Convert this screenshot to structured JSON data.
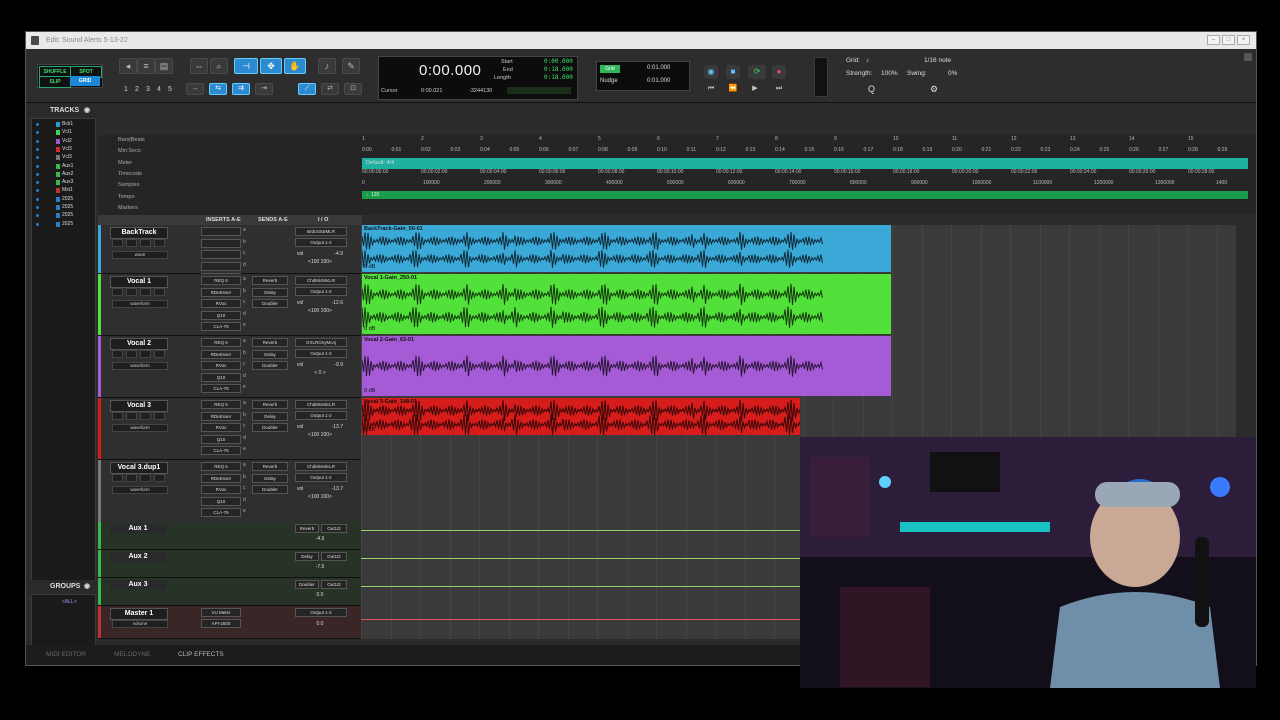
{
  "window": {
    "title": "Edit: Sound Alerts 5-13-22",
    "controls": [
      "–",
      "□",
      "×"
    ]
  },
  "toolbar": {
    "modes": [
      "SHUFFLE",
      "SPOT",
      "SLIP",
      "GRID"
    ],
    "zoom_presets": [
      "1",
      "2",
      "3",
      "4",
      "5"
    ],
    "counter": {
      "main": "0:00.000",
      "cursor_label": "Cursor",
      "cursor_value": "0:00.021",
      "sample": "-3244130",
      "start_label": "Start",
      "end_label": "End",
      "length_label": "Length",
      "start": "0:00.000",
      "end": "0:18.000",
      "length": "0:18.000"
    },
    "grid": {
      "badge": "Grid",
      "grid_value": "0:01.000",
      "nudge_label": "Nudge",
      "nudge_value": "0:01.000"
    },
    "quantize": {
      "grid_label": "Grid:",
      "grid_value": "1/16 note",
      "strength_label": "Strength:",
      "strength_value": "100%",
      "swing_label": "Swing:",
      "swing_value": "0%"
    }
  },
  "tracks_panel": {
    "header": "TRACKS",
    "items": [
      {
        "name": "Bck1",
        "color": "#2a9bd6"
      },
      {
        "name": "Vcl1",
        "color": "#3fd35a"
      },
      {
        "name": "Vcl2",
        "color": "#9b59d0"
      },
      {
        "name": "Vcl3",
        "color": "#d12a2a"
      },
      {
        "name": "Vcl3",
        "color": "#777777"
      },
      {
        "name": "Aux1",
        "color": "#3ab84a"
      },
      {
        "name": "Aux2",
        "color": "#3ab84a"
      },
      {
        "name": "Aux3",
        "color": "#3ab84a"
      },
      {
        "name": "Mst1",
        "color": "#c23030"
      },
      {
        "name": "2025",
        "color": "#2a7ac4"
      },
      {
        "name": "2025",
        "color": "#2a7ac4"
      },
      {
        "name": "2025",
        "color": "#2a7ac4"
      },
      {
        "name": "2025",
        "color": "#2a7ac4"
      }
    ]
  },
  "groups_panel": {
    "header": "GROUPS",
    "item": "<ALL>"
  },
  "rulers": {
    "labels": [
      "Bars|Beats",
      "Min:Secs",
      "Meter",
      "Timecode",
      "Samples",
      "Tempo",
      "Markers"
    ],
    "minsecs": [
      "0:00",
      "0:01",
      "0:02",
      "0:03",
      "0:04",
      "0:05",
      "0:06",
      "0:07",
      "0:08",
      "0:09",
      "0:10",
      "0:11",
      "0:12",
      "0:13",
      "0:14",
      "0:15",
      "0:16",
      "0:17",
      "0:18",
      "0:19",
      "0:20",
      "0:21",
      "0:22",
      "0:23",
      "0:24",
      "0:25",
      "0:26",
      "0:27",
      "0:28",
      "0:29"
    ],
    "bars": [
      "1",
      "2",
      "3",
      "4",
      "5",
      "6",
      "7",
      "8",
      "9",
      "10",
      "11",
      "12",
      "13",
      "14",
      "15"
    ],
    "timecode": [
      "00:00:00:00",
      "00:00:02:00",
      "00:00:04:00",
      "00:00:06:00",
      "00:00:08:00",
      "00:00:10:00",
      "00:00:12:00",
      "00:00:14:00",
      "00:00:16:00",
      "00:00:18:00",
      "00:00:20:00",
      "00:00:22:00",
      "00:00:24:00",
      "00:00:26:00",
      "00:00:28:00"
    ],
    "samples": [
      "0",
      "100000",
      "200000",
      "300000",
      "400000",
      "500000",
      "600000",
      "700000",
      "800000",
      "900000",
      "1000000",
      "1100000",
      "1200000",
      "1300000",
      "1400"
    ],
    "meter": "Default: 4/4",
    "tempo": "♩120"
  },
  "column_headers": {
    "inserts": "INSERTS A-E",
    "sends": "SENDS A-E",
    "io": "I / O"
  },
  "audio_tracks": [
    {
      "name": "BackTrack",
      "color": "#3aa9d8",
      "clip": "BackTrack-Gain_50-01",
      "gain": "0 dB",
      "view": "wave",
      "inserts": [
        "",
        "",
        "",
        "",
        ""
      ],
      "sends": [
        "",
        "",
        "",
        "",
        ""
      ],
      "io_in": "BrdcstStrMLR",
      "io_out": "Output 1-2",
      "vol": "-4.9",
      "pan": "<100  100>",
      "vol_label": "vol"
    },
    {
      "name": "Vocal 1",
      "color": "#52e03a",
      "clip": "Vocal 1-Gain_250-01",
      "gain": "0 dB",
      "view": "waveform",
      "inserts": [
        "REQ 6",
        "RDeEsser",
        "RVox",
        "Q10",
        "CLA-76"
      ],
      "sends": [
        "Reverb",
        "Delay",
        "Doubler",
        "",
        ""
      ],
      "io_in": "ChdMicMicLR",
      "io_out": "Output 1-2",
      "vol": "-12.6",
      "pan": "<100  100>",
      "vol_label": "vol"
    },
    {
      "name": "Vocal 2",
      "color": "#a55ad6",
      "clip": "Vocal 2-Gain_63-01",
      "gain": "0 dB",
      "view": "waveform",
      "inserts": [
        "REQ 6",
        "RDeEsser",
        "RVox",
        "Q10",
        "CLA-76"
      ],
      "sends": [
        "Reverb",
        "Delay",
        "Doubler",
        "",
        ""
      ],
      "io_in": "GXLROnyMcnj",
      "io_out": "Output 1-2",
      "vol": "-9.9",
      "pan": "< 0 >",
      "vol_label": "vol"
    },
    {
      "name": "Vocal 3",
      "color": "#d71c1c",
      "clip": "Vocal 3-Gain_148-01",
      "gain": "0 dB",
      "view": "waveform",
      "inserts": [
        "REQ 6",
        "RDeEsser",
        "RVox",
        "Q10",
        "CLA-76"
      ],
      "sends": [
        "Reverb",
        "Delay",
        "Doubler",
        "",
        ""
      ],
      "io_in": "ChdMicMicLR",
      "io_out": "Output 1-2",
      "vol": "-13.7",
      "pan": "<100  100>",
      "vol_label": "vol"
    },
    {
      "name": "Vocal 3.dup1",
      "color": "#7a7a7a",
      "clip": "",
      "gain": "",
      "view": "waveform",
      "inserts": [
        "REQ 6",
        "RDeEsser",
        "RVox",
        "Q10",
        "CLA-76"
      ],
      "sends": [
        "Reverb",
        "Delay",
        "Doubler",
        "",
        ""
      ],
      "io_in": "ChdMicMicLR",
      "io_out": "Output 1-2",
      "vol": "-13.7",
      "pan": "<100  100>",
      "vol_label": "vol"
    }
  ],
  "aux_tracks": [
    {
      "name": "Aux 1",
      "io_in": "Reverb",
      "io_out": "Out1t2",
      "vol": "-4.9"
    },
    {
      "name": "Aux 2",
      "io_in": "Delay",
      "io_out": "Out1t2",
      "vol": "-7.5"
    },
    {
      "name": "Aux 3",
      "io_in": "Doubler",
      "io_out": "Out1t2",
      "vol": "0.0"
    }
  ],
  "master": {
    "name": "Master 1",
    "view": "volume",
    "inserts": [
      "VU Meter",
      "API-2500"
    ],
    "io_out": "Output 1-2",
    "vol": "0.0"
  },
  "bottom_tabs": [
    "MIDI EDITOR",
    "MELODYNE",
    "CLIP EFFECTS"
  ],
  "colors": {
    "accent": "#2c8ad0",
    "green_led": "#43e073"
  }
}
